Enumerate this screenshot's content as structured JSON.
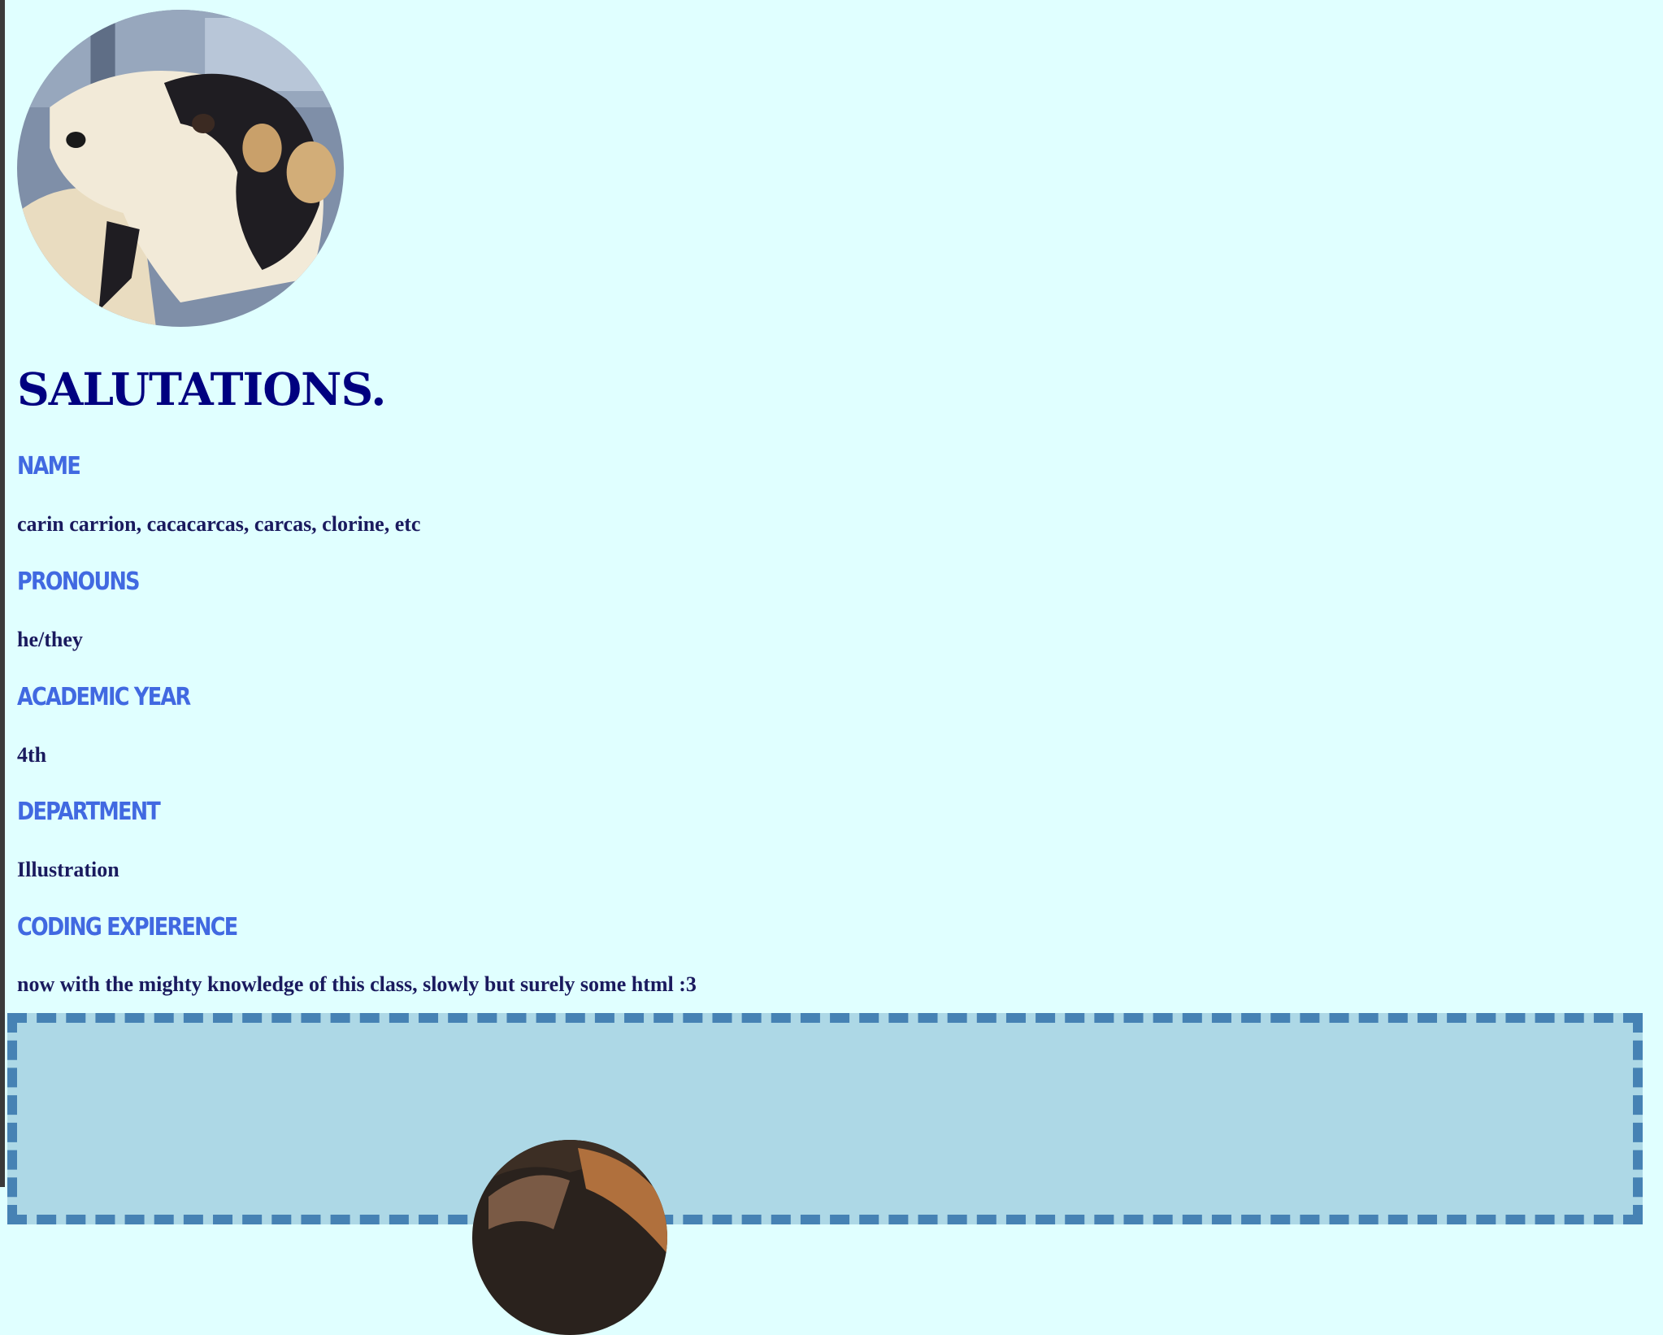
{
  "header": {
    "title": "SALUTATIONS."
  },
  "profile": {
    "name_label": "NAME",
    "name_value": "carin carrion, cacacarcas, carcas, clorine, etc",
    "pronouns_label": "PRONOUNS",
    "pronouns_value": "he/they",
    "year_label": "ACADEMIC YEAR",
    "year_value": "4th",
    "department_label": "DEPARTMENT",
    "department_value": "Illustration",
    "coding_label": "CODING EXPIERENCE",
    "coding_value": "now with the mighty knowledge of this class, slowly but surely some html :3"
  },
  "colors": {
    "page_background": "#e0ffff",
    "headline": "#000080",
    "label": "#4169e1",
    "value": "#1a1a5e",
    "panel_background": "#add8e6",
    "panel_border": "#4682b4"
  },
  "images": {
    "profile_photo": "dog-photo",
    "panel_photo": "cat-photo"
  }
}
